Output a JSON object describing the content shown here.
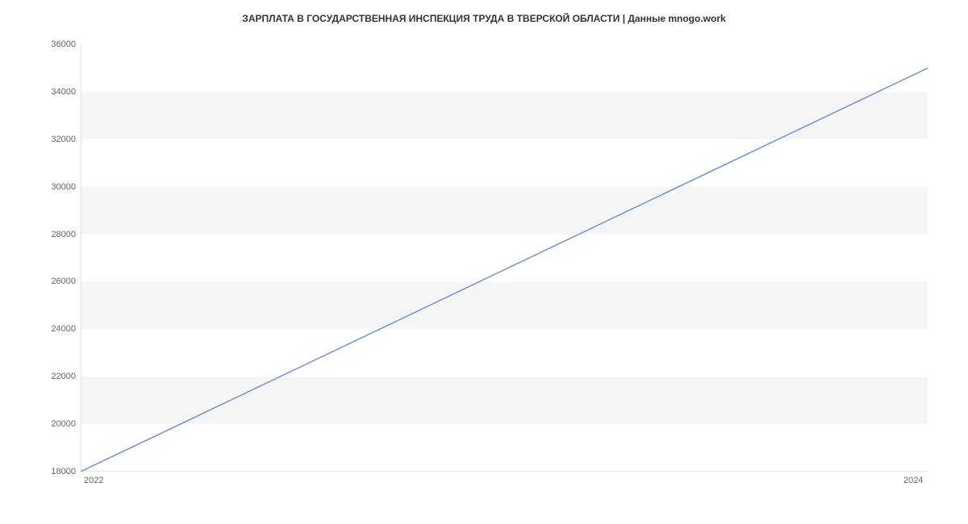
{
  "chart_data": {
    "type": "line",
    "title": "ЗАРПЛАТА В ГОСУДАРСТВЕННАЯ ИНСПЕКЦИЯ ТРУДА В ТВЕРСКОЙ ОБЛАСТИ | Данные mnogo.work",
    "x": [
      2022,
      2024
    ],
    "values": [
      18000,
      35000
    ],
    "xlabel": "",
    "ylabel": "",
    "xlim": [
      2022,
      2024
    ],
    "ylim": [
      18000,
      36000
    ],
    "x_ticks": [
      2022,
      2024
    ],
    "y_ticks": [
      18000,
      20000,
      22000,
      24000,
      26000,
      28000,
      30000,
      32000,
      34000,
      36000
    ],
    "grid": true,
    "line_color": "#7392cd",
    "band_color": "#f5f5f5"
  }
}
